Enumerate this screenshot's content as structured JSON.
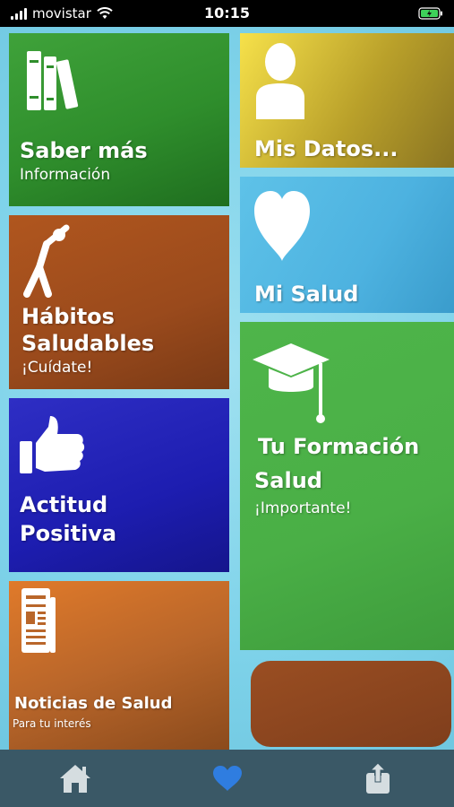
{
  "status_bar": {
    "carrier": "movistar",
    "time": "10:15"
  },
  "tiles": {
    "saber": {
      "title": "Saber más",
      "subtitle": "Información"
    },
    "habitos": {
      "title_line1": "Hábitos",
      "title_line2": "Saludables",
      "subtitle": "¡Cuídate!"
    },
    "actitud": {
      "title_line1": "Actitud",
      "title_line2": "Positiva"
    },
    "noticias": {
      "title": "Noticias de Salud",
      "subtitle": "Para tu interés"
    },
    "datos": {
      "title": "Mis Datos..."
    },
    "salud": {
      "title": "Mi Salud"
    },
    "formacion": {
      "title_line1": "Tu Formación",
      "title_line2": "Salud",
      "subtitle": "¡Importante!"
    }
  },
  "tab_bar": {
    "items": [
      "home-icon",
      "heart-icon",
      "share-icon"
    ],
    "active": "heart-icon",
    "active_color": "#2f7de0"
  }
}
